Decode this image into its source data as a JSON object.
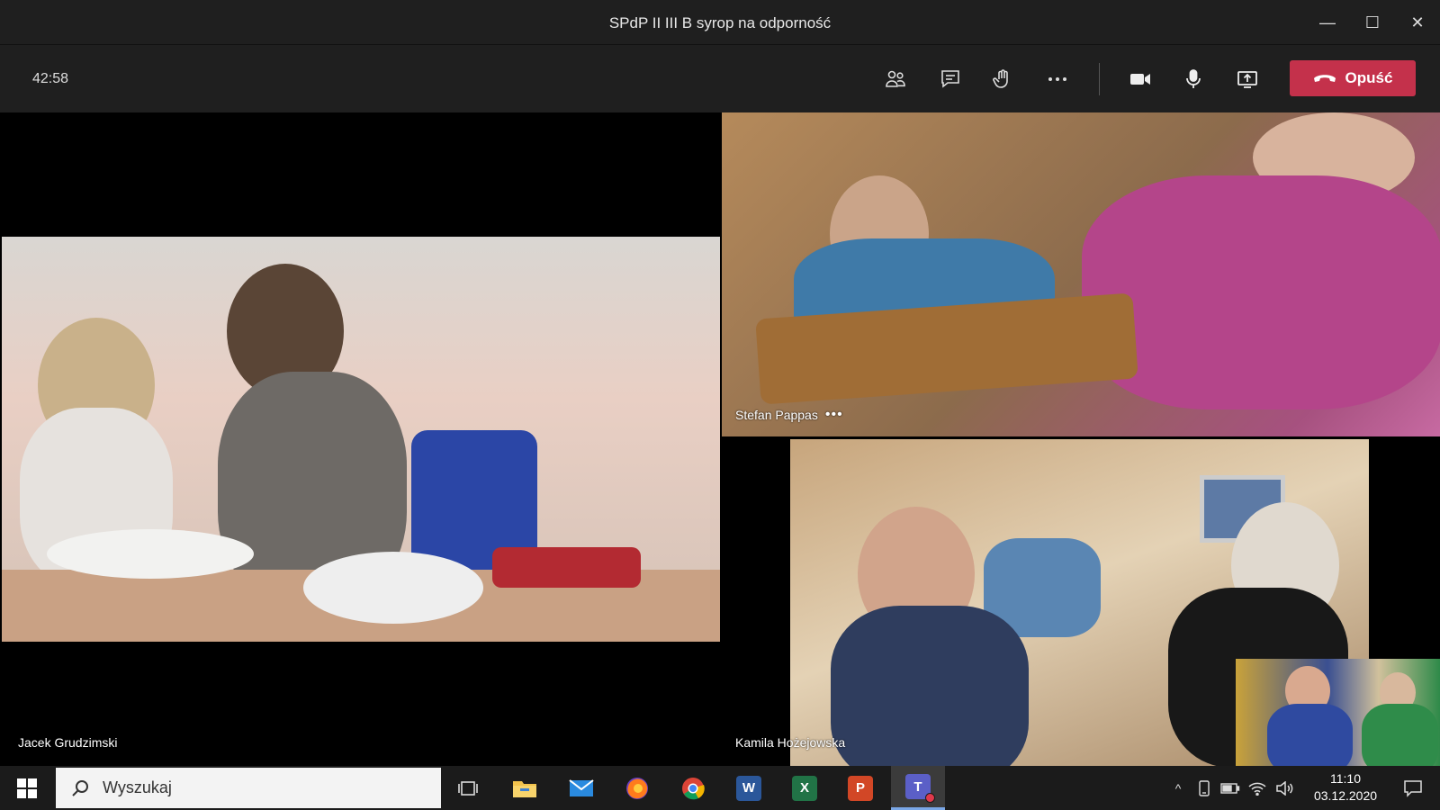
{
  "window": {
    "title": "SPdP II III B syrop na odporność",
    "controls": {
      "minimize": "—",
      "maximize": "☐",
      "close": "✕"
    }
  },
  "toolbar": {
    "timer": "42:58",
    "buttons": [
      {
        "id": "participants",
        "icon": "people-icon"
      },
      {
        "id": "chat",
        "icon": "chat-icon"
      },
      {
        "id": "raise-hand",
        "icon": "hand-icon"
      },
      {
        "id": "more",
        "icon": "more-icon"
      },
      {
        "id": "camera",
        "icon": "camera-icon"
      },
      {
        "id": "microphone",
        "icon": "microphone-icon"
      },
      {
        "id": "share",
        "icon": "share-tray-icon"
      }
    ],
    "leave_label": "Opuść",
    "leave_color": "#c4314b"
  },
  "participants": {
    "left": {
      "name": "Jacek Grudzimski"
    },
    "top_right": {
      "name": "Stefan Pappas",
      "more": "•••"
    },
    "bottom_right": {
      "name": "Kamila Hożejowska"
    }
  },
  "taskbar": {
    "search_placeholder": "Wyszukaj",
    "apps": [
      {
        "name": "task-view",
        "icon": "task-view-icon"
      },
      {
        "name": "file-explorer",
        "icon": "folder-icon"
      },
      {
        "name": "mail",
        "icon": "mail-icon"
      },
      {
        "name": "firefox",
        "icon": "firefox-icon"
      },
      {
        "name": "chrome",
        "icon": "chrome-icon"
      },
      {
        "name": "word",
        "icon": "word-icon",
        "letter": "W"
      },
      {
        "name": "excel",
        "icon": "excel-icon",
        "letter": "X"
      },
      {
        "name": "powerpoint",
        "icon": "powerpoint-icon",
        "letter": "P"
      },
      {
        "name": "teams",
        "icon": "teams-icon",
        "letter": "T"
      }
    ],
    "tray": {
      "chevron": "^",
      "time": "11:10",
      "date": "03.12.2020"
    }
  }
}
